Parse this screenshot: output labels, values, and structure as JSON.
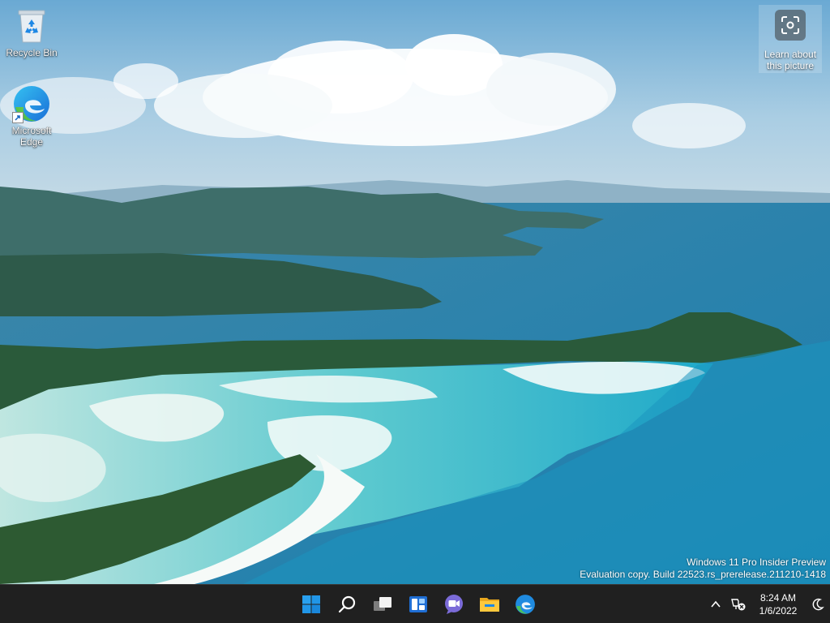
{
  "desktop": {
    "icons": [
      {
        "label": "Recycle Bin",
        "icon": "recycle-bin-icon"
      },
      {
        "label": "Microsoft Edge",
        "icon": "edge-icon"
      }
    ],
    "spotlight": {
      "label": "Learn about this picture",
      "icon": "camera-focus-icon"
    },
    "watermark": {
      "line1": "Windows 11 Pro Insider Preview",
      "line2": "Evaluation copy. Build 22523.rs_prerelease.211210-1418"
    }
  },
  "taskbar": {
    "apps": [
      {
        "name": "Start",
        "icon": "windows-start-icon"
      },
      {
        "name": "Search",
        "icon": "search-icon"
      },
      {
        "name": "Task View",
        "icon": "task-view-icon"
      },
      {
        "name": "Widgets",
        "icon": "widgets-icon"
      },
      {
        "name": "Chat",
        "icon": "chat-icon"
      },
      {
        "name": "File Explorer",
        "icon": "file-explorer-icon"
      },
      {
        "name": "Microsoft Edge",
        "icon": "edge-icon"
      }
    ],
    "tray": {
      "chevron_icon": "chevron-up-icon",
      "network_icon": "network-disconnected-icon",
      "time": "8:24 AM",
      "date": "1/6/2022",
      "focus_icon": "moon-icon"
    }
  },
  "colors": {
    "taskbar_bg": "#202020",
    "start_blue": "#2b9be8",
    "sky": "#7bb6d9",
    "lagoon": "#3fc0c8"
  }
}
